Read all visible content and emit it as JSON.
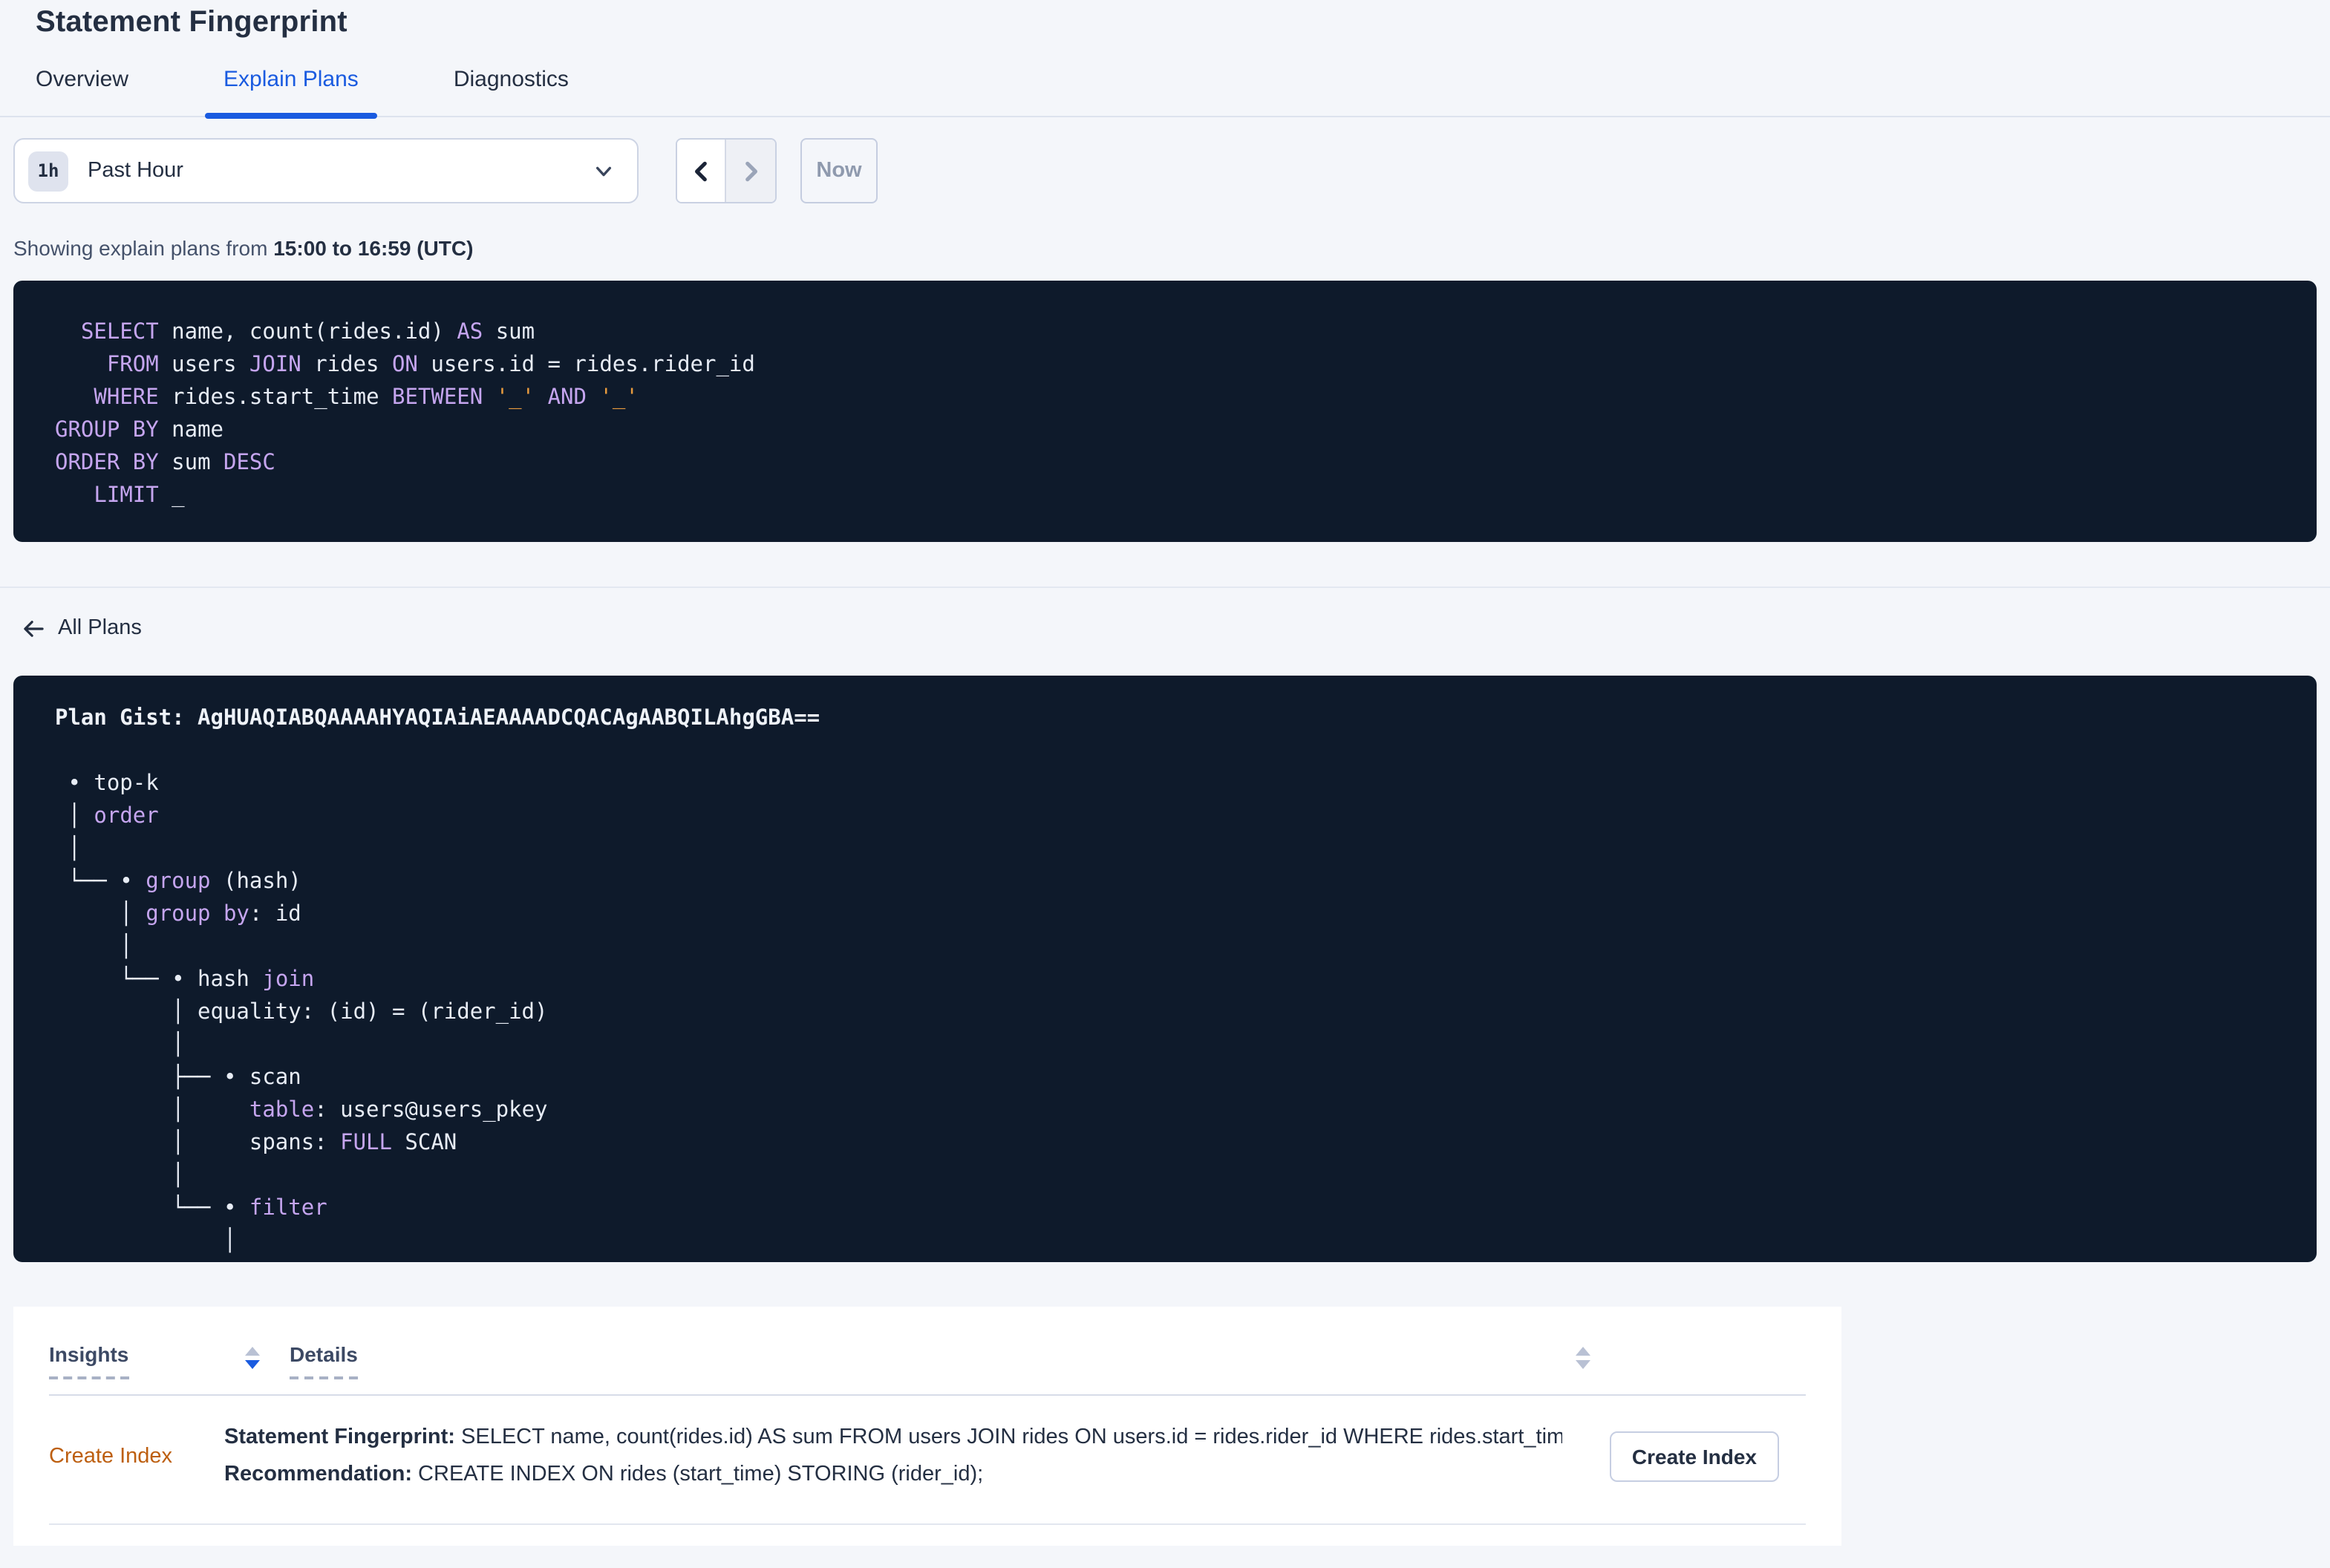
{
  "page": {
    "title": "Statement Fingerprint"
  },
  "tabs": [
    {
      "label": "Overview",
      "active": false
    },
    {
      "label": "Explain Plans",
      "active": true
    },
    {
      "label": "Diagnostics",
      "active": false
    }
  ],
  "time_picker": {
    "badge": "1h",
    "label": "Past Hour",
    "now_label": "Now"
  },
  "showing": {
    "prefix": "Showing explain plans from ",
    "range": "15:00 to 16:59 (UTC)"
  },
  "sql_lines": [
    [
      [
        "p",
        "  "
      ],
      [
        "k",
        "SELECT"
      ],
      [
        "p",
        " name, count(rides.id) "
      ],
      [
        "k",
        "AS"
      ],
      [
        "p",
        " sum"
      ]
    ],
    [
      [
        "p",
        "    "
      ],
      [
        "k",
        "FROM"
      ],
      [
        "p",
        " users "
      ],
      [
        "k",
        "JOIN"
      ],
      [
        "p",
        " rides "
      ],
      [
        "k",
        "ON"
      ],
      [
        "p",
        " users.id = rides.rider_id"
      ]
    ],
    [
      [
        "p",
        "   "
      ],
      [
        "k",
        "WHERE"
      ],
      [
        "p",
        " rides.start_time "
      ],
      [
        "k",
        "BETWEEN"
      ],
      [
        "p",
        " "
      ],
      [
        "o",
        "'_'"
      ],
      [
        "p",
        " "
      ],
      [
        "k",
        "AND"
      ],
      [
        "p",
        " "
      ],
      [
        "o",
        "'_'"
      ]
    ],
    [
      [
        "k",
        "GROUP BY"
      ],
      [
        "p",
        " name"
      ]
    ],
    [
      [
        "k",
        "ORDER BY"
      ],
      [
        "p",
        " sum "
      ],
      [
        "k",
        "DESC"
      ]
    ],
    [
      [
        "p",
        "   "
      ],
      [
        "k",
        "LIMIT"
      ],
      [
        "p",
        " _"
      ]
    ]
  ],
  "all_plans": {
    "label": "All Plans"
  },
  "plan_lines": [
    [
      [
        "b",
        "Plan Gist: AgHUAQIABQAAAAHYAQIAiAEAAAADCQACAgAABQILAhgGBA=="
      ]
    ],
    [
      [
        "p",
        ""
      ]
    ],
    [
      [
        "p",
        " • top-k"
      ]
    ],
    [
      [
        "p",
        " │ "
      ],
      [
        "k",
        "order"
      ]
    ],
    [
      [
        "p",
        " │"
      ]
    ],
    [
      [
        "p",
        " └── • "
      ],
      [
        "k",
        "group"
      ],
      [
        "p",
        " (hash)"
      ]
    ],
    [
      [
        "p",
        "     │ "
      ],
      [
        "k",
        "group by"
      ],
      [
        "p",
        ": id"
      ]
    ],
    [
      [
        "p",
        "     │"
      ]
    ],
    [
      [
        "p",
        "     └── • hash "
      ],
      [
        "k",
        "join"
      ]
    ],
    [
      [
        "p",
        "         │ equality: (id) = (rider_id)"
      ]
    ],
    [
      [
        "p",
        "         │"
      ]
    ],
    [
      [
        "p",
        "         ├── • scan"
      ]
    ],
    [
      [
        "p",
        "         │     "
      ],
      [
        "k",
        "table"
      ],
      [
        "p",
        ": users@users_pkey"
      ]
    ],
    [
      [
        "p",
        "         │     spans: "
      ],
      [
        "k",
        "FULL"
      ],
      [
        "p",
        " SCAN"
      ]
    ],
    [
      [
        "p",
        "         │"
      ]
    ],
    [
      [
        "p",
        "         └── • "
      ],
      [
        "k",
        "filter"
      ]
    ],
    [
      [
        "p",
        "             │"
      ]
    ]
  ],
  "table": {
    "headers": [
      "Insights",
      "Details"
    ],
    "rows": [
      {
        "insight": "Create Index",
        "lines": [
          {
            "label": "Statement Fingerprint:",
            "text": " SELECT name, count(rides.id) AS sum FROM users JOIN rides ON users.id = rides.rider_id WHERE rides.start_time BETWEEN '_…"
          },
          {
            "label": "Recommendation:",
            "text": " CREATE INDEX ON rides (start_time) STORING (rider_id);"
          }
        ],
        "action_label": "Create Index"
      }
    ]
  },
  "colors": {
    "accent_blue": "#1a5be0",
    "code_background": "#0e1a2b",
    "code_keyword_purple": "#c5a5ef",
    "code_plain": "#e7ecf5",
    "code_literal_orange": "#e89b3e",
    "insight_link_orange": "#bd5f10",
    "page_background": "#f4f6fa"
  }
}
